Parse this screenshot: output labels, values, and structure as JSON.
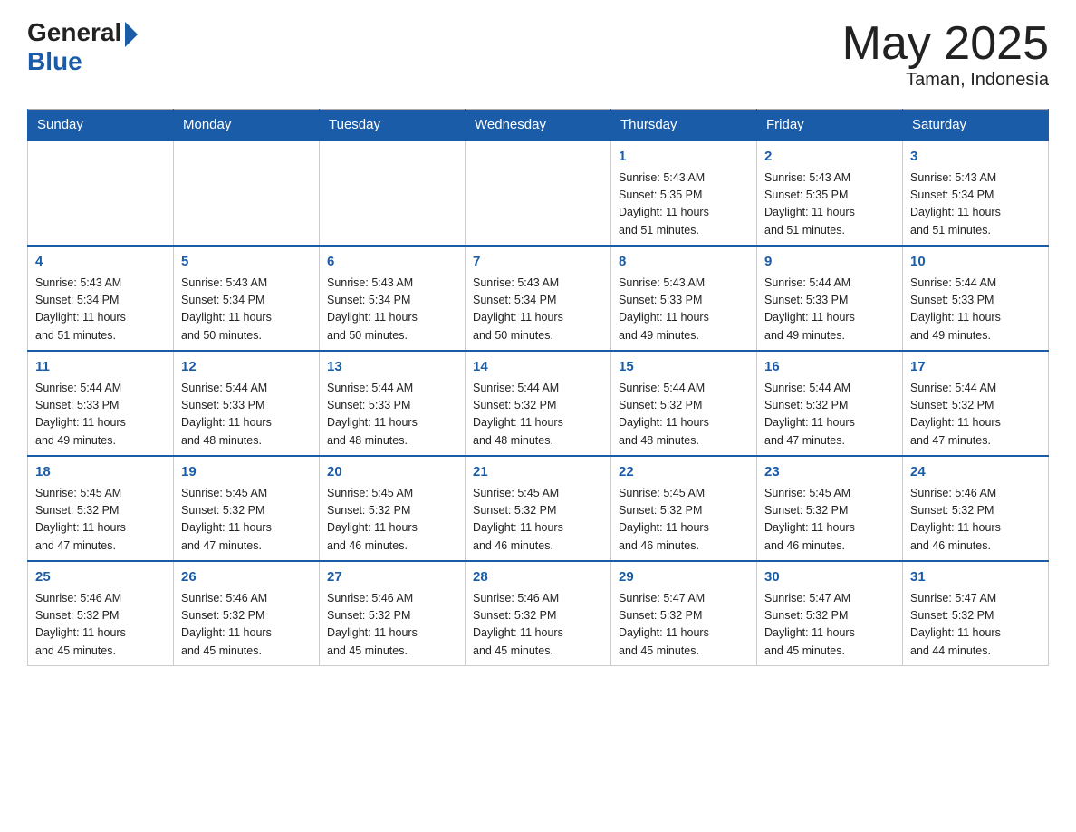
{
  "header": {
    "logo_general": "General",
    "logo_blue": "Blue",
    "month_title": "May 2025",
    "location": "Taman, Indonesia"
  },
  "days_of_week": [
    "Sunday",
    "Monday",
    "Tuesday",
    "Wednesday",
    "Thursday",
    "Friday",
    "Saturday"
  ],
  "weeks": [
    {
      "cells": [
        {
          "day": "",
          "info": ""
        },
        {
          "day": "",
          "info": ""
        },
        {
          "day": "",
          "info": ""
        },
        {
          "day": "",
          "info": ""
        },
        {
          "day": "1",
          "info": "Sunrise: 5:43 AM\nSunset: 5:35 PM\nDaylight: 11 hours\nand 51 minutes."
        },
        {
          "day": "2",
          "info": "Sunrise: 5:43 AM\nSunset: 5:35 PM\nDaylight: 11 hours\nand 51 minutes."
        },
        {
          "day": "3",
          "info": "Sunrise: 5:43 AM\nSunset: 5:34 PM\nDaylight: 11 hours\nand 51 minutes."
        }
      ]
    },
    {
      "cells": [
        {
          "day": "4",
          "info": "Sunrise: 5:43 AM\nSunset: 5:34 PM\nDaylight: 11 hours\nand 51 minutes."
        },
        {
          "day": "5",
          "info": "Sunrise: 5:43 AM\nSunset: 5:34 PM\nDaylight: 11 hours\nand 50 minutes."
        },
        {
          "day": "6",
          "info": "Sunrise: 5:43 AM\nSunset: 5:34 PM\nDaylight: 11 hours\nand 50 minutes."
        },
        {
          "day": "7",
          "info": "Sunrise: 5:43 AM\nSunset: 5:34 PM\nDaylight: 11 hours\nand 50 minutes."
        },
        {
          "day": "8",
          "info": "Sunrise: 5:43 AM\nSunset: 5:33 PM\nDaylight: 11 hours\nand 49 minutes."
        },
        {
          "day": "9",
          "info": "Sunrise: 5:44 AM\nSunset: 5:33 PM\nDaylight: 11 hours\nand 49 minutes."
        },
        {
          "day": "10",
          "info": "Sunrise: 5:44 AM\nSunset: 5:33 PM\nDaylight: 11 hours\nand 49 minutes."
        }
      ]
    },
    {
      "cells": [
        {
          "day": "11",
          "info": "Sunrise: 5:44 AM\nSunset: 5:33 PM\nDaylight: 11 hours\nand 49 minutes."
        },
        {
          "day": "12",
          "info": "Sunrise: 5:44 AM\nSunset: 5:33 PM\nDaylight: 11 hours\nand 48 minutes."
        },
        {
          "day": "13",
          "info": "Sunrise: 5:44 AM\nSunset: 5:33 PM\nDaylight: 11 hours\nand 48 minutes."
        },
        {
          "day": "14",
          "info": "Sunrise: 5:44 AM\nSunset: 5:32 PM\nDaylight: 11 hours\nand 48 minutes."
        },
        {
          "day": "15",
          "info": "Sunrise: 5:44 AM\nSunset: 5:32 PM\nDaylight: 11 hours\nand 48 minutes."
        },
        {
          "day": "16",
          "info": "Sunrise: 5:44 AM\nSunset: 5:32 PM\nDaylight: 11 hours\nand 47 minutes."
        },
        {
          "day": "17",
          "info": "Sunrise: 5:44 AM\nSunset: 5:32 PM\nDaylight: 11 hours\nand 47 minutes."
        }
      ]
    },
    {
      "cells": [
        {
          "day": "18",
          "info": "Sunrise: 5:45 AM\nSunset: 5:32 PM\nDaylight: 11 hours\nand 47 minutes."
        },
        {
          "day": "19",
          "info": "Sunrise: 5:45 AM\nSunset: 5:32 PM\nDaylight: 11 hours\nand 47 minutes."
        },
        {
          "day": "20",
          "info": "Sunrise: 5:45 AM\nSunset: 5:32 PM\nDaylight: 11 hours\nand 46 minutes."
        },
        {
          "day": "21",
          "info": "Sunrise: 5:45 AM\nSunset: 5:32 PM\nDaylight: 11 hours\nand 46 minutes."
        },
        {
          "day": "22",
          "info": "Sunrise: 5:45 AM\nSunset: 5:32 PM\nDaylight: 11 hours\nand 46 minutes."
        },
        {
          "day": "23",
          "info": "Sunrise: 5:45 AM\nSunset: 5:32 PM\nDaylight: 11 hours\nand 46 minutes."
        },
        {
          "day": "24",
          "info": "Sunrise: 5:46 AM\nSunset: 5:32 PM\nDaylight: 11 hours\nand 46 minutes."
        }
      ]
    },
    {
      "cells": [
        {
          "day": "25",
          "info": "Sunrise: 5:46 AM\nSunset: 5:32 PM\nDaylight: 11 hours\nand 45 minutes."
        },
        {
          "day": "26",
          "info": "Sunrise: 5:46 AM\nSunset: 5:32 PM\nDaylight: 11 hours\nand 45 minutes."
        },
        {
          "day": "27",
          "info": "Sunrise: 5:46 AM\nSunset: 5:32 PM\nDaylight: 11 hours\nand 45 minutes."
        },
        {
          "day": "28",
          "info": "Sunrise: 5:46 AM\nSunset: 5:32 PM\nDaylight: 11 hours\nand 45 minutes."
        },
        {
          "day": "29",
          "info": "Sunrise: 5:47 AM\nSunset: 5:32 PM\nDaylight: 11 hours\nand 45 minutes."
        },
        {
          "day": "30",
          "info": "Sunrise: 5:47 AM\nSunset: 5:32 PM\nDaylight: 11 hours\nand 45 minutes."
        },
        {
          "day": "31",
          "info": "Sunrise: 5:47 AM\nSunset: 5:32 PM\nDaylight: 11 hours\nand 44 minutes."
        }
      ]
    }
  ]
}
